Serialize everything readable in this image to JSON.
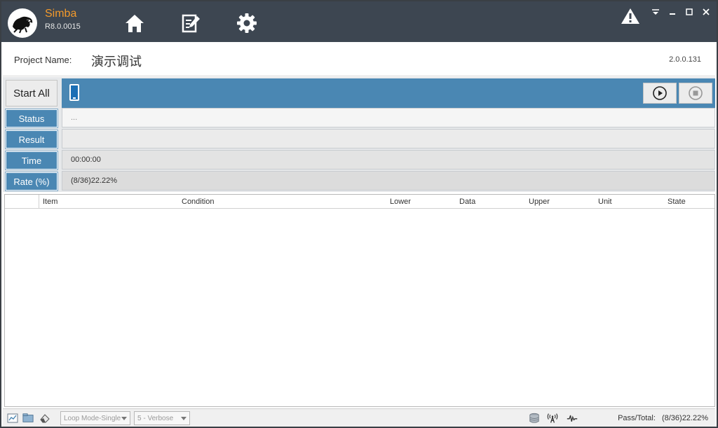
{
  "app": {
    "name": "Simba",
    "version": "R8.0.0015"
  },
  "nav": [
    "home-icon",
    "edit-icon",
    "gear-icon"
  ],
  "project": {
    "label": "Project Name:",
    "name": "演示调试",
    "build": "2.0.0.131"
  },
  "controls": {
    "start_all": "Start All",
    "rows": {
      "status": {
        "label": "Status",
        "value": "..."
      },
      "result": {
        "label": "Result",
        "value": ""
      },
      "time": {
        "label": "Time",
        "value": "00:00:00"
      },
      "rate": {
        "label": "Rate (%)",
        "value": "(8/36)22.22%"
      }
    }
  },
  "table": {
    "columns": [
      "Item",
      "Condition",
      "Lower",
      "Data",
      "Upper",
      "Unit",
      "State"
    ],
    "rows": []
  },
  "statusbar": {
    "loop_mode": "Loop Mode-Single",
    "verbose": "5 - Verbose",
    "pass_total_label": "Pass/Total:",
    "pass_total_value": "(8/36)22.22%"
  },
  "colors": {
    "topbar": "#3d4651",
    "accent": "#4a87b3",
    "brand": "#f39a2b"
  }
}
